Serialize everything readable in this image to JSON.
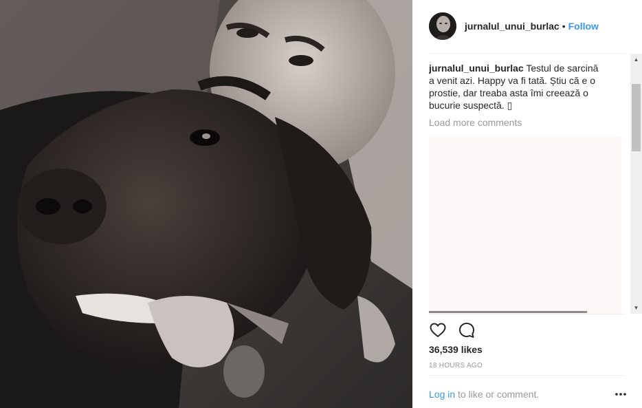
{
  "post": {
    "username": "jurnalul_unui_burlac",
    "separator_dot": "•",
    "follow_label": "Follow"
  },
  "caption": {
    "username": "jurnalul_unui_burlac",
    "text": "Testul de sarcină a venit azi. Happy va fi tată. Știu că e o prostie, dar treaba asta îmi creează o bucurie suspectă. ▯"
  },
  "comments": {
    "load_more_label": "Load more comments"
  },
  "engagement": {
    "likes": "36,539 likes",
    "timestamp": "18 HOURS AGO"
  },
  "footer": {
    "login_link": "Log in",
    "login_suffix": " to like or comment."
  },
  "icons": {
    "like": "heart-icon",
    "comment": "comment-bubble-icon",
    "more": "more-options-icon",
    "scroll_up": "scroll-up-arrow-icon",
    "scroll_down": "scroll-down-arrow-icon"
  },
  "colors": {
    "link_blue": "#3897f0",
    "text_dark": "#262626",
    "text_muted": "#999999"
  }
}
